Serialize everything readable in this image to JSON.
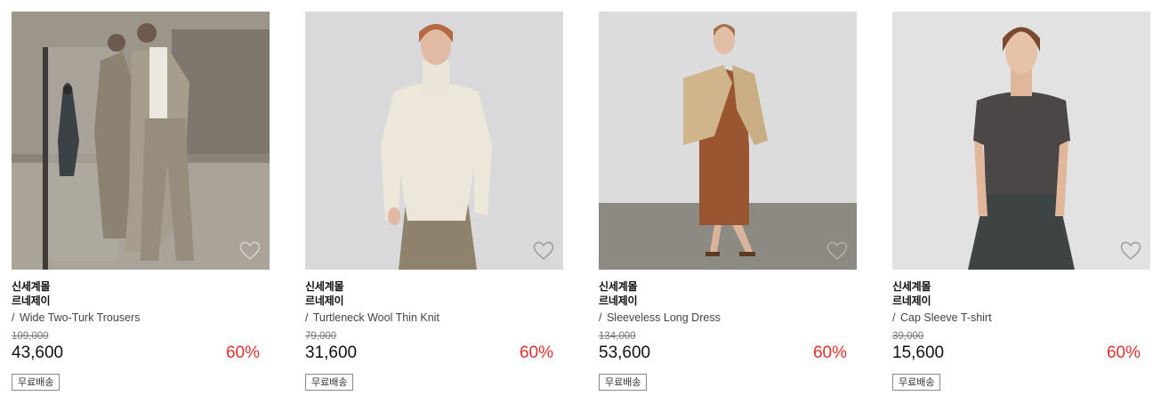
{
  "products": [
    {
      "mall": "신세계몰",
      "brand": "르네제이",
      "name": "Wide Two-Turk Trousers",
      "slash": "/",
      "original_price": "109,000",
      "sale_price": "43,600",
      "discount": "60%",
      "badge": "무료배송"
    },
    {
      "mall": "신세계몰",
      "brand": "르네제이",
      "name": "Turtleneck Wool Thin Knit",
      "slash": "/",
      "original_price": "79,000",
      "sale_price": "31,600",
      "discount": "60%",
      "badge": "무료배송"
    },
    {
      "mall": "신세계몰",
      "brand": "르네제이",
      "name": "Sleeveless Long Dress",
      "slash": "/",
      "original_price": "134,000",
      "sale_price": "53,600",
      "discount": "60%",
      "badge": "무료배송"
    },
    {
      "mall": "신세계몰",
      "brand": "르네제이",
      "name": "Cap Sleeve T-shirt",
      "slash": "/",
      "original_price": "39,000",
      "sale_price": "15,600",
      "discount": "60%",
      "badge": "무료배송"
    }
  ],
  "colors": {
    "discount": "#e0312e",
    "strike": "#777777",
    "badge_border": "#8a8a8a",
    "heart": "#9a9a9a"
  },
  "icons": {
    "wishlist": "heart-outline-icon"
  }
}
